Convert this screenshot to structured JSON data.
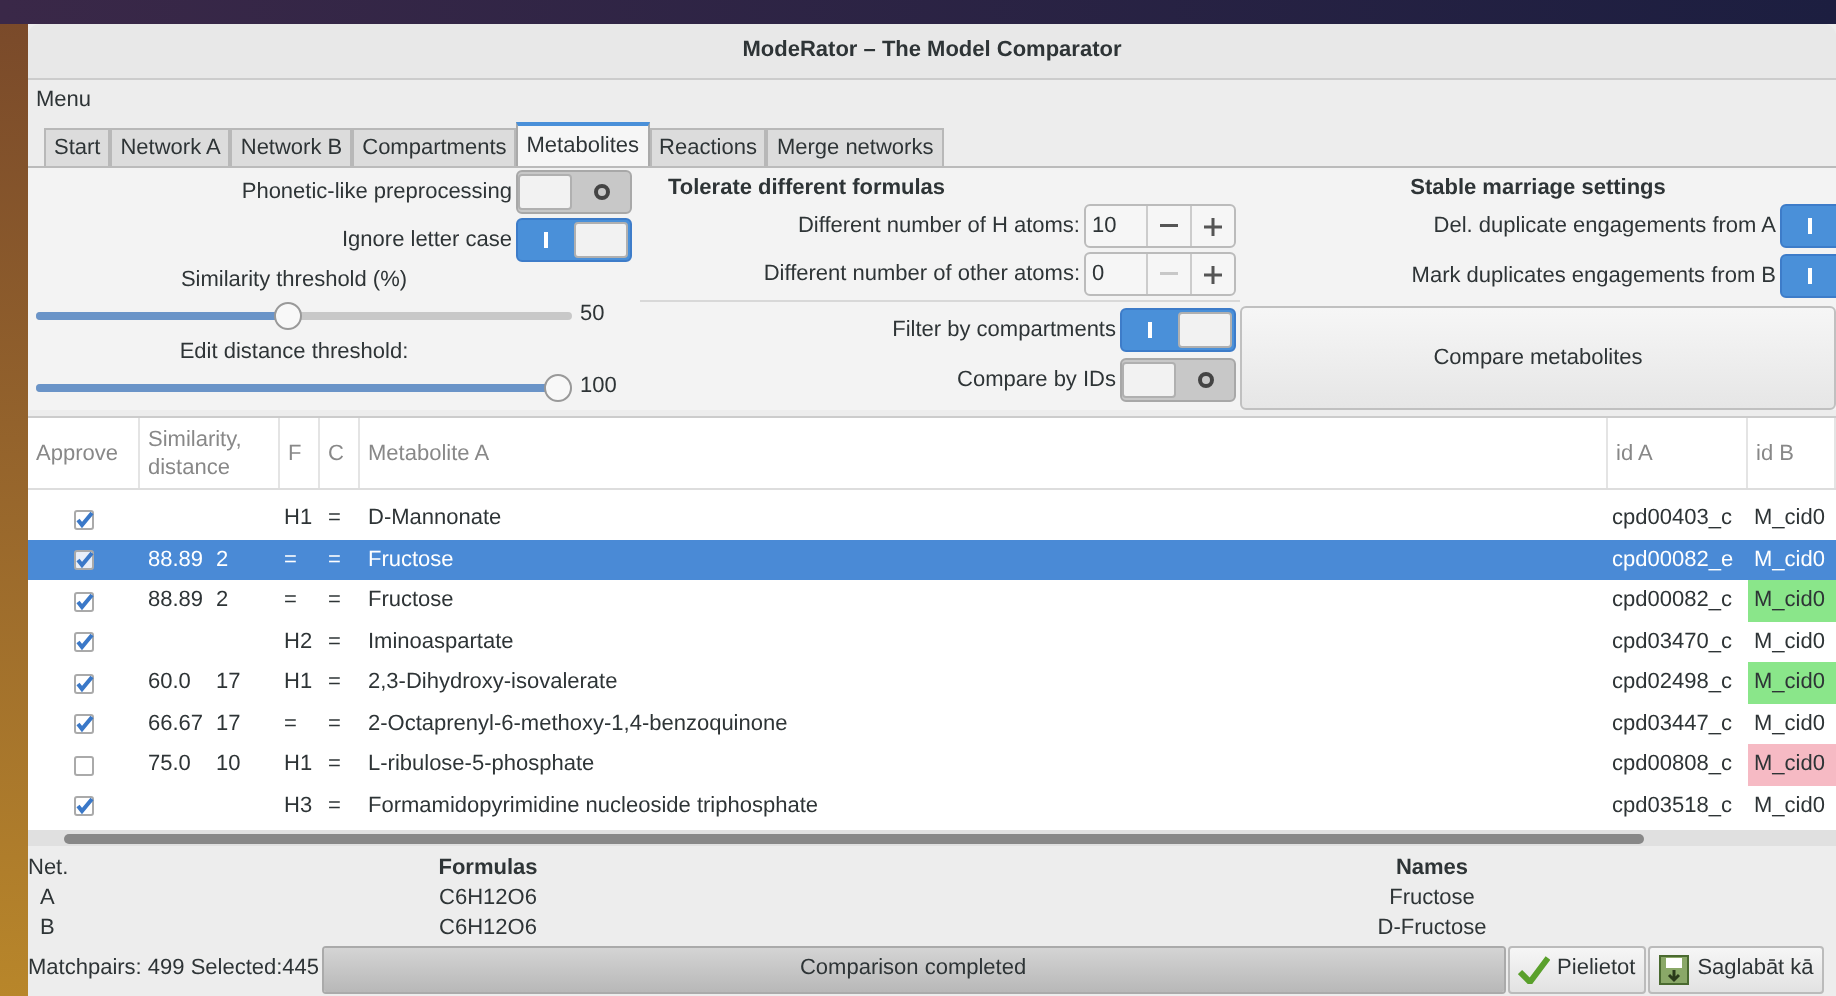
{
  "window": {
    "title": "ModeRator – The Model Comparator"
  },
  "menu": {
    "label": "Menu"
  },
  "tabs": [
    {
      "label": "Start",
      "selected": false
    },
    {
      "label": "Network A",
      "selected": false
    },
    {
      "label": "Network B",
      "selected": false
    },
    {
      "label": "Compartments",
      "selected": false
    },
    {
      "label": "Metabolites",
      "selected": true
    },
    {
      "label": "Reactions",
      "selected": false
    },
    {
      "label": "Merge networks",
      "selected": false
    }
  ],
  "preprocessing": [
    {
      "label": "Phonetic-like preprocessing",
      "on": false
    },
    {
      "label": "Ignore letter case",
      "on": true
    }
  ],
  "sliders": [
    {
      "label": "Similarity threshold (%)",
      "level": 0.47,
      "reading": "50"
    },
    {
      "label": "Edit distance threshold:",
      "level": 1,
      "reading": "100"
    }
  ],
  "formulas": {
    "title": "Tolerate different formulas",
    "spinners": [
      {
        "label": "Different number of H atoms:",
        "value": "10",
        "minus_disabled": false
      },
      {
        "label": "Different number of other atoms:",
        "value": "0",
        "minus_disabled": true
      }
    ]
  },
  "filters": [
    {
      "label": "Filter by compartments",
      "on": true
    },
    {
      "label": "Compare by IDs",
      "on": false
    }
  ],
  "stable_marriage": {
    "title": "Stable marriage settings",
    "toggles": [
      {
        "label": "Del. duplicate engagements from A",
        "on": true
      },
      {
        "label": "Mark duplicates engagements from B",
        "on": true
      }
    ]
  },
  "compare_button": "Compare metabolites",
  "table": {
    "columns": [
      "Approve",
      "Similarity, distance",
      "F",
      "C",
      "Metabolite A",
      "id A",
      "id B"
    ],
    "rows": [
      {
        "approved": true,
        "selected": false,
        "similarity": "",
        "distance": "",
        "f": "H1",
        "c": "=",
        "metabolite": "D-Mannonate",
        "id_a": "cpd00403_c",
        "id_b": "M_cid0"
      },
      {
        "approved": true,
        "selected": true,
        "similarity": "88.89",
        "distance": "2",
        "f": "=",
        "c": "=",
        "metabolite": "Fructose",
        "id_a": "cpd00082_e",
        "id_b": "M_cid0"
      },
      {
        "approved": true,
        "selected": false,
        "similarity": "88.89",
        "distance": "2",
        "f": "=",
        "c": "=",
        "metabolite": "Fructose",
        "id_a": "cpd00082_c",
        "id_b": "M_cid0",
        "color": "#8ae68a"
      },
      {
        "approved": true,
        "selected": false,
        "similarity": "",
        "distance": "",
        "f": "H2",
        "c": "=",
        "metabolite": "Iminoaspartate",
        "id_a": "cpd03470_c",
        "id_b": "M_cid0"
      },
      {
        "approved": true,
        "selected": false,
        "similarity": "60.0",
        "distance": "17",
        "f": "H1",
        "c": "=",
        "metabolite": "2,3-Dihydroxy-isovalerate",
        "id_a": "cpd02498_c",
        "id_b": "M_cid0",
        "color": "#8ae68a"
      },
      {
        "approved": true,
        "selected": false,
        "similarity": "66.67",
        "distance": "17",
        "f": "=",
        "c": "=",
        "metabolite": "2-Octaprenyl-6-methoxy-1,4-benzoquinone",
        "id_a": "cpd03447_c",
        "id_b": "M_cid0"
      },
      {
        "approved": false,
        "selected": false,
        "similarity": "75.0",
        "distance": "10",
        "f": "H1",
        "c": "=",
        "metabolite": "L-ribulose-5-phosphate",
        "id_a": "cpd00808_c",
        "id_b": "M_cid0",
        "color": "#f6bac4"
      },
      {
        "approved": true,
        "selected": false,
        "similarity": "",
        "distance": "",
        "f": "H3",
        "c": "=",
        "metabolite": "Formamidopyrimidine nucleoside triphosphate",
        "id_a": "cpd03518_c",
        "id_b": "M_cid0"
      }
    ]
  },
  "details": {
    "columns": [
      "Net.",
      "Formulas",
      "Names"
    ],
    "rows": [
      [
        "A",
        "C6H12O6",
        "Fructose"
      ],
      [
        "B",
        "C6H12O6",
        "D-Fructose"
      ]
    ]
  },
  "status": {
    "text": "Matchpairs: 499 Selected:445",
    "progress": {
      "label": "Comparison completed",
      "level": 1
    },
    "buttons": [
      "Pielietot",
      "Saglabāt kā"
    ]
  }
}
